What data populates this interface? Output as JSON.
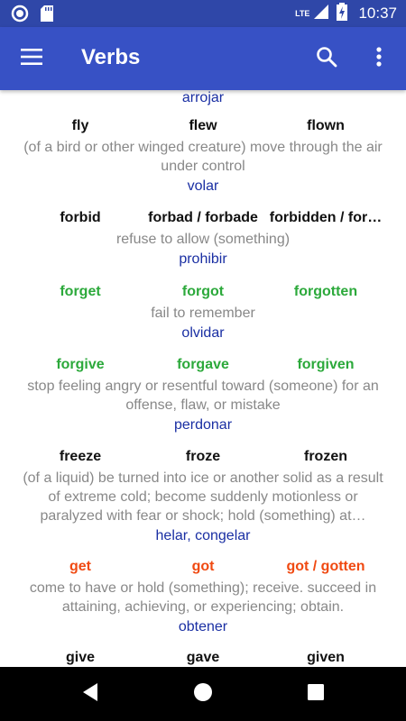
{
  "status_bar": {
    "network": "LTE",
    "time": "10:37"
  },
  "app_bar": {
    "title": "Verbs"
  },
  "list": {
    "top_translation": "arrojar",
    "entries": [
      {
        "base": "fly",
        "past": "flew",
        "participle": "flown",
        "color": "#111111",
        "definition": "(of a bird or other winged creature) move through the air under control",
        "translation": "volar"
      },
      {
        "base": "forbid",
        "past": "forbad / forbade",
        "participle": "forbidden / for…",
        "color": "#111111",
        "definition": "refuse to allow (something)",
        "translation": "prohibir"
      },
      {
        "base": "forget",
        "past": "forgot",
        "participle": "forgotten",
        "color": "#2ca93b",
        "definition": "fail to remember",
        "translation": "olvidar"
      },
      {
        "base": "forgive",
        "past": "forgave",
        "participle": "forgiven",
        "color": "#2ca93b",
        "definition": "stop feeling angry or resentful toward (someone) for an offense, flaw, or mistake",
        "translation": "perdonar"
      },
      {
        "base": "freeze",
        "past": "froze",
        "participle": "frozen",
        "color": "#111111",
        "definition": "(of a liquid) be turned into ice or another solid as a result of extreme cold; become suddenly motionless or paralyzed with fear or shock; hold (something) at…",
        "translation": "helar, congelar"
      },
      {
        "base": "get",
        "past": "got",
        "participle": "got / gotten",
        "color": "#f04a12",
        "definition": "come to have or hold (something); receive. succeed in attaining, achieving, or experiencing; obtain.",
        "translation": "obtener"
      },
      {
        "base": "give",
        "past": "gave",
        "participle": "given",
        "color": "#111111"
      }
    ]
  },
  "icons": {
    "menu": "hamburger-menu-icon",
    "search": "search-icon",
    "more": "more-vert-icon",
    "back": "nav-back-icon",
    "home": "nav-home-icon",
    "recents": "nav-recents-icon"
  },
  "colors": {
    "status_bar": "#2f47a8",
    "app_bar": "#3751c5",
    "translation": "#1a2fa3",
    "definition": "#888888"
  }
}
